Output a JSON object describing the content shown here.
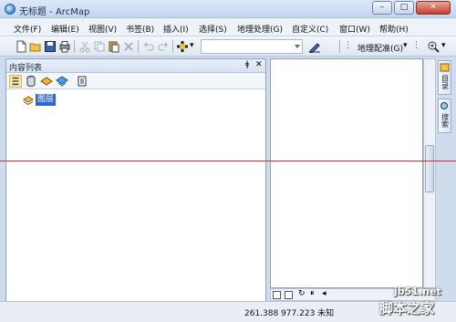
{
  "window": {
    "title": "无标题 - ArcMap",
    "minimize": "–",
    "maximize": "□",
    "close": "✕"
  },
  "menu": [
    "文件(F)",
    "编辑(E)",
    "视图(V)",
    "书签(B)",
    "插入(I)",
    "选择(S)",
    "地理处理(G)",
    "自定义(C)",
    "窗口(W)",
    "帮助(H)"
  ],
  "toolbar": {
    "geoprocessing_label": "地理配准(G)",
    "scale_value": "",
    "dropdown_arrow": "▾"
  },
  "toc": {
    "title": "内容列表",
    "pin": "ǂ",
    "close": "✕",
    "layer": "图层"
  },
  "side_tabs": [
    {
      "label": "目录",
      "icon": "catalog-icon"
    },
    {
      "label": "搜索",
      "icon": "search-icon"
    }
  ],
  "statusbar": {
    "coordinates": "261.388  977.223 未知"
  },
  "watermark": {
    "site": "jb51.net",
    "name": "脚本之家"
  },
  "colors": {
    "selection": "#3165c8",
    "red_line": "#e4242b",
    "close_button": "#c3402e"
  }
}
